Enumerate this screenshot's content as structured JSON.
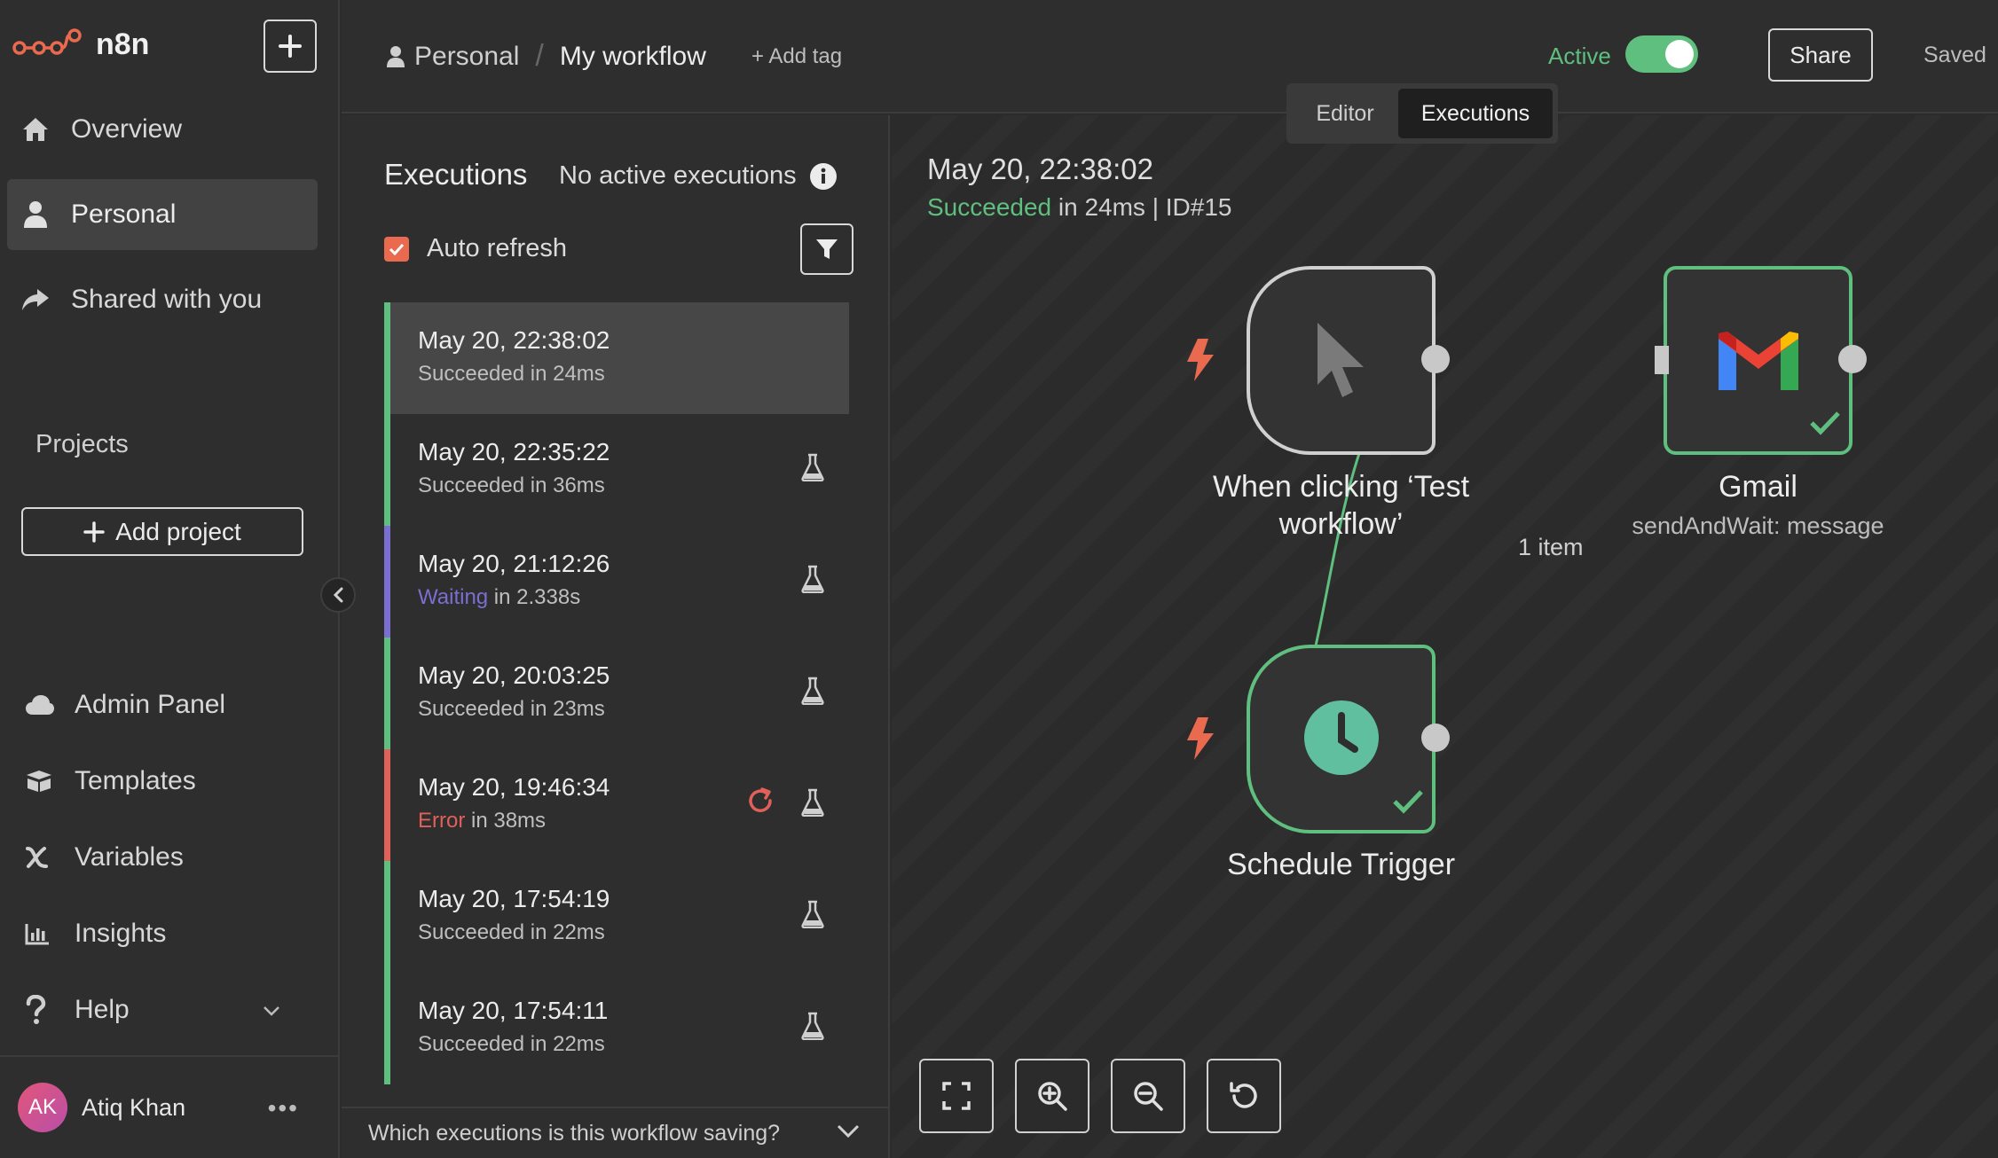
{
  "app": {
    "name": "n8n"
  },
  "sidebar": {
    "nav": [
      {
        "label": "Overview",
        "icon": "home-icon"
      },
      {
        "label": "Personal",
        "icon": "user-icon",
        "active": true
      },
      {
        "label": "Shared with you",
        "icon": "share-icon"
      }
    ],
    "projects_title": "Projects",
    "add_project_label": "Add project",
    "bottom": [
      {
        "label": "Admin Panel",
        "icon": "cloud-icon"
      },
      {
        "label": "Templates",
        "icon": "box-icon"
      },
      {
        "label": "Variables",
        "icon": "variable-icon"
      },
      {
        "label": "Insights",
        "icon": "chart-icon"
      },
      {
        "label": "Help",
        "icon": "help-icon"
      }
    ],
    "user": {
      "initials": "AK",
      "name": "Atiq Khan",
      "more": "•••"
    }
  },
  "header": {
    "project": "Personal",
    "workflow": "My workflow",
    "add_tag": "+ Add tag",
    "active_label": "Active",
    "active": true,
    "share_label": "Share",
    "saved_label": "Saved",
    "tabs": [
      "Editor",
      "Executions"
    ],
    "selected_tab": "Executions"
  },
  "executions": {
    "title": "Executions",
    "no_active": "No active executions",
    "auto_refresh_label": "Auto refresh",
    "auto_refresh": true,
    "items": [
      {
        "date": "May 20, 22:38:02",
        "status": "Succeeded",
        "suffix": " in 24ms",
        "state": "success",
        "selected": true
      },
      {
        "date": "May 20, 22:35:22",
        "status": "Succeeded",
        "suffix": " in 36ms",
        "state": "success"
      },
      {
        "date": "May 20, 21:12:26",
        "status": "Waiting",
        "suffix": " in 2.338s",
        "state": "waiting"
      },
      {
        "date": "May 20, 20:03:25",
        "status": "Succeeded",
        "suffix": " in 23ms",
        "state": "success"
      },
      {
        "date": "May 20, 19:46:34",
        "status": "Error",
        "suffix": " in 38ms",
        "state": "error"
      },
      {
        "date": "May 20, 17:54:19",
        "status": "Succeeded",
        "suffix": " in 22ms",
        "state": "success"
      },
      {
        "date": "May 20, 17:54:11",
        "status": "Succeeded",
        "suffix": " in 22ms",
        "state": "success"
      }
    ],
    "saving_question": "Which executions is this workflow saving?"
  },
  "canvas": {
    "execution_date": "May 20, 22:38:02",
    "status": "Succeeded",
    "details": " in 24ms | ID#15",
    "nodes": {
      "manual": {
        "label_line1": "When clicking ‘Test",
        "label_line2": "workflow’"
      },
      "gmail": {
        "label": "Gmail",
        "subtitle": "sendAndWait: message"
      },
      "schedule": {
        "label": "Schedule Trigger"
      }
    },
    "edge_label": "1 item"
  },
  "colors": {
    "success": "#5fbf7f",
    "error": "#e0605a",
    "waiting": "#7a6fd0",
    "accent": "#ea6a4f"
  }
}
